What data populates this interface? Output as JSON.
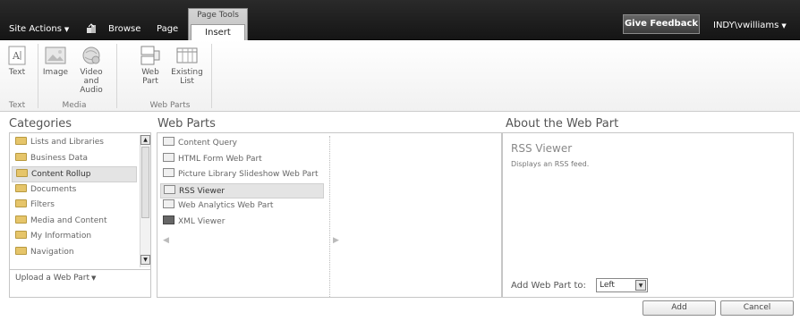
{
  "topbar": {
    "site_actions": "Site Actions",
    "browse": "Browse",
    "page": "Page",
    "page_tools": "Page Tools",
    "insert": "Insert",
    "give_feedback": "Give Feedback",
    "user": "INDY\\vwilliams"
  },
  "ribbon": {
    "text_group": {
      "buttons": [
        "Text"
      ],
      "label": "Text"
    },
    "media_group": {
      "buttons": [
        "Image",
        "Video and Audio"
      ],
      "label": "Media"
    },
    "webparts_group": {
      "buttons": [
        "Web Part",
        "Existing List"
      ],
      "label": "Web Parts"
    }
  },
  "categories": {
    "title": "Categories",
    "items": [
      "Lists and Libraries",
      "Business Data",
      "Content Rollup",
      "Documents",
      "Filters",
      "Media and Content",
      "My Information",
      "Navigation"
    ],
    "selected": "Content Rollup",
    "upload": "Upload a Web Part"
  },
  "webparts": {
    "title": "Web Parts",
    "items": [
      "Content Query",
      "HTML Form Web Part",
      "Picture Library Slideshow Web Part",
      "RSS Viewer",
      "Web Analytics Web Part",
      "XML Viewer"
    ],
    "selected": "RSS Viewer"
  },
  "about": {
    "title": "About the Web Part",
    "name": "RSS Viewer",
    "description": "Displays an RSS feed.",
    "add_to_label": "Add Web Part to:",
    "zone": "Left"
  },
  "buttons": {
    "add": "Add",
    "cancel": "Cancel"
  }
}
